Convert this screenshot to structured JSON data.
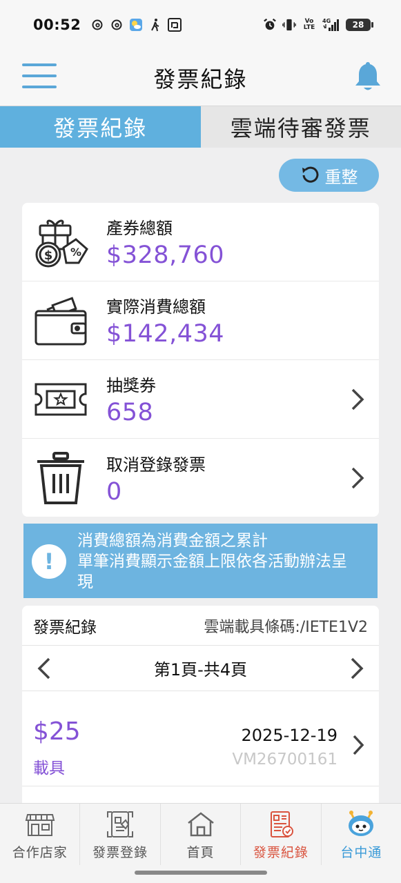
{
  "status_bar": {
    "time": "00:52",
    "left_icons": [
      "threads-icon",
      "threads-icon",
      "weather-icon",
      "walking-icon",
      "app-icon"
    ],
    "right_icons": [
      "alarm-icon",
      "vibrate-icon",
      "volte-icon",
      "signal-icon"
    ],
    "volte": "Vo\nLTE",
    "network": "4G",
    "battery": "28"
  },
  "header": {
    "title": "發票紀錄"
  },
  "tabs": [
    {
      "label": "發票紀錄",
      "active": true
    },
    {
      "label": "雲端待審發票",
      "active": false
    }
  ],
  "refresh": {
    "label": "重整"
  },
  "summary": {
    "items": [
      {
        "label": "產券總額",
        "value": "$328,760",
        "icon": "gift-coupon-icon"
      },
      {
        "label": "實際消費總額",
        "value": "$142,434",
        "icon": "wallet-icon"
      },
      {
        "label": "抽獎券",
        "value": "658",
        "icon": "ticket-icon"
      },
      {
        "label": "取消登錄發票",
        "value": "0",
        "icon": "trash-icon"
      }
    ]
  },
  "notice": {
    "text_line1": "消費總額為消費金額之累計",
    "text_line2": "單筆消費顯示金額上限依各活動辦法呈",
    "text_line3": "現"
  },
  "records": {
    "title": "發票紀錄",
    "carrier": "雲端載具條碼:/IETE1V2",
    "pager": "第1頁-共4頁",
    "items": [
      {
        "amount": "$25",
        "type": "載具",
        "date": "2025-12-19",
        "number": "VM26700161"
      }
    ]
  },
  "bottom_nav": {
    "items": [
      {
        "label": "合作店家",
        "icon": "store-icon"
      },
      {
        "label": "發票登錄",
        "icon": "invoice-scan-icon"
      },
      {
        "label": "首頁",
        "icon": "home-icon"
      },
      {
        "label": "發票紀錄",
        "icon": "invoice-record-icon"
      },
      {
        "label": "台中通",
        "icon": "robot-mascot-icon"
      }
    ]
  },
  "colors": {
    "accent_blue": "#5fb0de",
    "value_purple": "#8452d6",
    "current_nav_red": "#d9533e"
  }
}
